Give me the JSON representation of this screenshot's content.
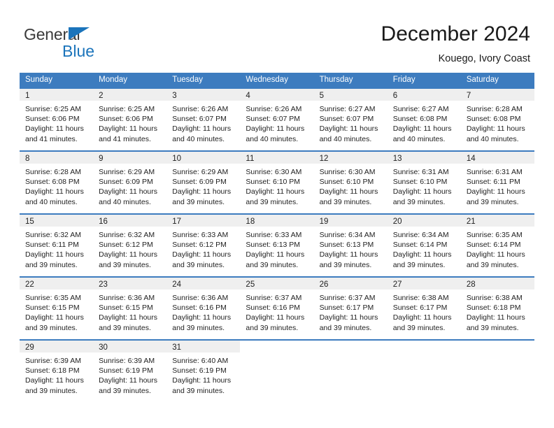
{
  "brand": {
    "name_part1": "General",
    "name_part2": "Blue",
    "triangle_icon": "triangle-icon",
    "accent_color": "#1b74bb"
  },
  "header": {
    "title": "December 2024",
    "subtitle": "Kouego, Ivory Coast"
  },
  "calendar": {
    "header_bg": "#3d7cbf",
    "row_band_bg": "#efefef",
    "weekday_headers": [
      "Sunday",
      "Monday",
      "Tuesday",
      "Wednesday",
      "Thursday",
      "Friday",
      "Saturday"
    ],
    "weeks": [
      [
        {
          "day": "1",
          "sunrise": "Sunrise: 6:25 AM",
          "sunset": "Sunset: 6:06 PM",
          "daylight1": "Daylight: 11 hours",
          "daylight2": "and 41 minutes."
        },
        {
          "day": "2",
          "sunrise": "Sunrise: 6:25 AM",
          "sunset": "Sunset: 6:06 PM",
          "daylight1": "Daylight: 11 hours",
          "daylight2": "and 41 minutes."
        },
        {
          "day": "3",
          "sunrise": "Sunrise: 6:26 AM",
          "sunset": "Sunset: 6:07 PM",
          "daylight1": "Daylight: 11 hours",
          "daylight2": "and 40 minutes."
        },
        {
          "day": "4",
          "sunrise": "Sunrise: 6:26 AM",
          "sunset": "Sunset: 6:07 PM",
          "daylight1": "Daylight: 11 hours",
          "daylight2": "and 40 minutes."
        },
        {
          "day": "5",
          "sunrise": "Sunrise: 6:27 AM",
          "sunset": "Sunset: 6:07 PM",
          "daylight1": "Daylight: 11 hours",
          "daylight2": "and 40 minutes."
        },
        {
          "day": "6",
          "sunrise": "Sunrise: 6:27 AM",
          "sunset": "Sunset: 6:08 PM",
          "daylight1": "Daylight: 11 hours",
          "daylight2": "and 40 minutes."
        },
        {
          "day": "7",
          "sunrise": "Sunrise: 6:28 AM",
          "sunset": "Sunset: 6:08 PM",
          "daylight1": "Daylight: 11 hours",
          "daylight2": "and 40 minutes."
        }
      ],
      [
        {
          "day": "8",
          "sunrise": "Sunrise: 6:28 AM",
          "sunset": "Sunset: 6:08 PM",
          "daylight1": "Daylight: 11 hours",
          "daylight2": "and 40 minutes."
        },
        {
          "day": "9",
          "sunrise": "Sunrise: 6:29 AM",
          "sunset": "Sunset: 6:09 PM",
          "daylight1": "Daylight: 11 hours",
          "daylight2": "and 40 minutes."
        },
        {
          "day": "10",
          "sunrise": "Sunrise: 6:29 AM",
          "sunset": "Sunset: 6:09 PM",
          "daylight1": "Daylight: 11 hours",
          "daylight2": "and 39 minutes."
        },
        {
          "day": "11",
          "sunrise": "Sunrise: 6:30 AM",
          "sunset": "Sunset: 6:10 PM",
          "daylight1": "Daylight: 11 hours",
          "daylight2": "and 39 minutes."
        },
        {
          "day": "12",
          "sunrise": "Sunrise: 6:30 AM",
          "sunset": "Sunset: 6:10 PM",
          "daylight1": "Daylight: 11 hours",
          "daylight2": "and 39 minutes."
        },
        {
          "day": "13",
          "sunrise": "Sunrise: 6:31 AM",
          "sunset": "Sunset: 6:10 PM",
          "daylight1": "Daylight: 11 hours",
          "daylight2": "and 39 minutes."
        },
        {
          "day": "14",
          "sunrise": "Sunrise: 6:31 AM",
          "sunset": "Sunset: 6:11 PM",
          "daylight1": "Daylight: 11 hours",
          "daylight2": "and 39 minutes."
        }
      ],
      [
        {
          "day": "15",
          "sunrise": "Sunrise: 6:32 AM",
          "sunset": "Sunset: 6:11 PM",
          "daylight1": "Daylight: 11 hours",
          "daylight2": "and 39 minutes."
        },
        {
          "day": "16",
          "sunrise": "Sunrise: 6:32 AM",
          "sunset": "Sunset: 6:12 PM",
          "daylight1": "Daylight: 11 hours",
          "daylight2": "and 39 minutes."
        },
        {
          "day": "17",
          "sunrise": "Sunrise: 6:33 AM",
          "sunset": "Sunset: 6:12 PM",
          "daylight1": "Daylight: 11 hours",
          "daylight2": "and 39 minutes."
        },
        {
          "day": "18",
          "sunrise": "Sunrise: 6:33 AM",
          "sunset": "Sunset: 6:13 PM",
          "daylight1": "Daylight: 11 hours",
          "daylight2": "and 39 minutes."
        },
        {
          "day": "19",
          "sunrise": "Sunrise: 6:34 AM",
          "sunset": "Sunset: 6:13 PM",
          "daylight1": "Daylight: 11 hours",
          "daylight2": "and 39 minutes."
        },
        {
          "day": "20",
          "sunrise": "Sunrise: 6:34 AM",
          "sunset": "Sunset: 6:14 PM",
          "daylight1": "Daylight: 11 hours",
          "daylight2": "and 39 minutes."
        },
        {
          "day": "21",
          "sunrise": "Sunrise: 6:35 AM",
          "sunset": "Sunset: 6:14 PM",
          "daylight1": "Daylight: 11 hours",
          "daylight2": "and 39 minutes."
        }
      ],
      [
        {
          "day": "22",
          "sunrise": "Sunrise: 6:35 AM",
          "sunset": "Sunset: 6:15 PM",
          "daylight1": "Daylight: 11 hours",
          "daylight2": "and 39 minutes."
        },
        {
          "day": "23",
          "sunrise": "Sunrise: 6:36 AM",
          "sunset": "Sunset: 6:15 PM",
          "daylight1": "Daylight: 11 hours",
          "daylight2": "and 39 minutes."
        },
        {
          "day": "24",
          "sunrise": "Sunrise: 6:36 AM",
          "sunset": "Sunset: 6:16 PM",
          "daylight1": "Daylight: 11 hours",
          "daylight2": "and 39 minutes."
        },
        {
          "day": "25",
          "sunrise": "Sunrise: 6:37 AM",
          "sunset": "Sunset: 6:16 PM",
          "daylight1": "Daylight: 11 hours",
          "daylight2": "and 39 minutes."
        },
        {
          "day": "26",
          "sunrise": "Sunrise: 6:37 AM",
          "sunset": "Sunset: 6:17 PM",
          "daylight1": "Daylight: 11 hours",
          "daylight2": "and 39 minutes."
        },
        {
          "day": "27",
          "sunrise": "Sunrise: 6:38 AM",
          "sunset": "Sunset: 6:17 PM",
          "daylight1": "Daylight: 11 hours",
          "daylight2": "and 39 minutes."
        },
        {
          "day": "28",
          "sunrise": "Sunrise: 6:38 AM",
          "sunset": "Sunset: 6:18 PM",
          "daylight1": "Daylight: 11 hours",
          "daylight2": "and 39 minutes."
        }
      ],
      [
        {
          "day": "29",
          "sunrise": "Sunrise: 6:39 AM",
          "sunset": "Sunset: 6:18 PM",
          "daylight1": "Daylight: 11 hours",
          "daylight2": "and 39 minutes."
        },
        {
          "day": "30",
          "sunrise": "Sunrise: 6:39 AM",
          "sunset": "Sunset: 6:19 PM",
          "daylight1": "Daylight: 11 hours",
          "daylight2": "and 39 minutes."
        },
        {
          "day": "31",
          "sunrise": "Sunrise: 6:40 AM",
          "sunset": "Sunset: 6:19 PM",
          "daylight1": "Daylight: 11 hours",
          "daylight2": "and 39 minutes."
        },
        {
          "day": "",
          "sunrise": "",
          "sunset": "",
          "daylight1": "",
          "daylight2": ""
        },
        {
          "day": "",
          "sunrise": "",
          "sunset": "",
          "daylight1": "",
          "daylight2": ""
        },
        {
          "day": "",
          "sunrise": "",
          "sunset": "",
          "daylight1": "",
          "daylight2": ""
        },
        {
          "day": "",
          "sunrise": "",
          "sunset": "",
          "daylight1": "",
          "daylight2": ""
        }
      ]
    ]
  }
}
